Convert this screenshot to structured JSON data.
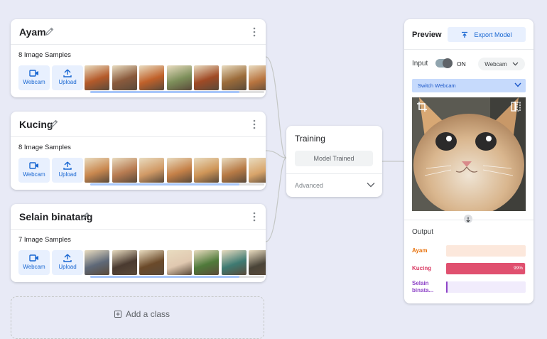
{
  "classes": [
    {
      "name": "Ayam",
      "samples": "8 Image Samples",
      "thumb_colors": [
        "#b45a2a",
        "#8a5a3c",
        "#c0612a",
        "#7d8f5a",
        "#a04a25",
        "#9b6b3a",
        "#b8743f",
        "#8d5030"
      ]
    },
    {
      "name": "Kucing",
      "samples": "8 Image Samples",
      "thumb_colors": [
        "#c9884f",
        "#b87c52",
        "#d19a66",
        "#c58148",
        "#cf9658",
        "#b77a45",
        "#d8a46a",
        "#c08b5c"
      ]
    },
    {
      "name": "Selain binatang",
      "samples": "7 Image Samples",
      "thumb_colors": [
        "#5e6878",
        "#4a3a30",
        "#6b4a2a",
        "#e0c8b0",
        "#4f7a3a",
        "#3e7a72",
        "#4a4438"
      ]
    }
  ],
  "upload_tiles": {
    "webcam": "Webcam",
    "upload": "Upload"
  },
  "add_class": "Add a class",
  "training": {
    "title": "Training",
    "button": "Model Trained",
    "advanced": "Advanced"
  },
  "preview": {
    "title": "Preview",
    "export": "Export Model",
    "input_label": "Input",
    "toggle_state": "ON",
    "source": "Webcam",
    "switch": "Switch Webcam",
    "output_label": "Output",
    "outputs": [
      {
        "label": "Ayam",
        "value": 0,
        "color": "#e8710a",
        "bg": "#fce8dc",
        "fill": "#f6aea9",
        "text": ""
      },
      {
        "label": "Kucing",
        "value": 0.99,
        "color": "#d93a63",
        "bg": "#fbd9e2",
        "fill": "#e0506f",
        "text": "99%"
      },
      {
        "label": "Selain binata...",
        "value": 0.01,
        "color": "#8e44c7",
        "bg": "#f1ecfc",
        "fill": "#8e44c7",
        "text": ""
      }
    ]
  }
}
